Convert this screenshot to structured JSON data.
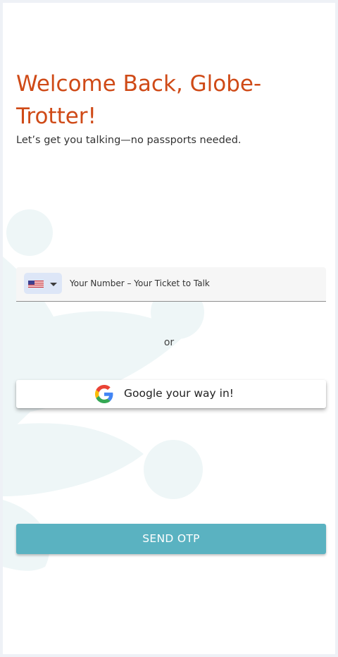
{
  "header": {
    "title": "Welcome Back, Globe-Trotter!",
    "subtitle": "Let’s get you talking—no passports needed."
  },
  "phone": {
    "country_flag": "us-flag-icon",
    "placeholder": "Your Number – Your Ticket to Talk",
    "value": ""
  },
  "divider": {
    "text": "or"
  },
  "google_button": {
    "label": "Google your way in!",
    "icon": "google-icon"
  },
  "send_button": {
    "label": "SEND OTP"
  },
  "colors": {
    "title": "#cf4a17",
    "primary_button": "#5ab2c1",
    "country_select_bg": "#dde6f7",
    "decor": "#eef6f7"
  }
}
